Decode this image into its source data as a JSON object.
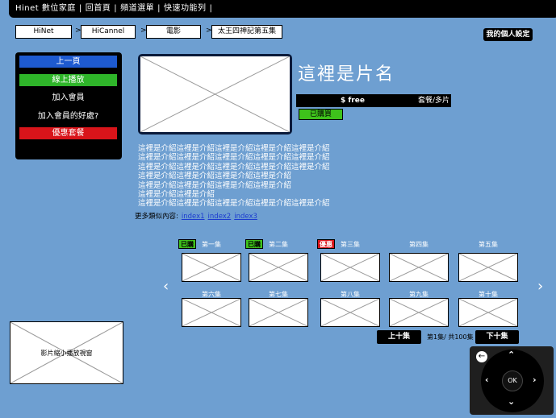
{
  "topbar": {
    "brand": "Hinet 數位家庭",
    "links": [
      "回首頁",
      "頻道選單",
      "快速功能列"
    ]
  },
  "breadcrumb": [
    "HiNet",
    "HiCannel",
    "電影",
    "太王四神記第五集"
  ],
  "breadcrumb_sep": ">",
  "my_settings": "我的個人設定",
  "menu": {
    "items": [
      {
        "label": "上一頁",
        "color": "#1e5ad0"
      },
      {
        "label": "線上播放",
        "color": "#2fb52a"
      },
      {
        "label": "加入會員",
        "color": ""
      },
      {
        "label": "加入會員的好處?",
        "color": ""
      },
      {
        "label": "優惠套餐",
        "color": "#d8141a"
      }
    ]
  },
  "movie": {
    "title": "這裡是片名",
    "price": "$ free",
    "price_unit": "套餐/多片",
    "purchased": "已購買",
    "description": [
      "這裡是介紹這裡是介紹這裡是介紹這裡是介紹這裡是介紹",
      "這裡是介紹這裡是介紹這裡是介紹這裡是介紹這裡是介紹",
      "這裡是介紹這裡是介紹這裡是介紹這裡是介紹這裡是介紹",
      "這裡是介紹這裡是介紹這裡是介紹這裡是介紹",
      "這裡是介紹這裡是介紹這裡是介紹這裡是介紹",
      "這裡是介紹這裡是介紹",
      "這裡是介紹這裡是介紹這裡是介紹這裡是介紹這裡是介紹"
    ],
    "more_label": "更多類似內容:",
    "more_links": [
      "index1",
      "index2",
      "index3"
    ]
  },
  "episodes": {
    "items": [
      {
        "label": "第一集",
        "badge": "已購",
        "badge_color": "#3ec21b"
      },
      {
        "label": "第二集",
        "badge": "已購",
        "badge_color": "#3ec21b"
      },
      {
        "label": "第三集",
        "badge": "優惠",
        "badge_color": "#d8141a"
      },
      {
        "label": "第四集",
        "badge": "",
        "badge_color": ""
      },
      {
        "label": "第五集",
        "badge": "",
        "badge_color": ""
      },
      {
        "label": "第六集",
        "badge": "",
        "badge_color": ""
      },
      {
        "label": "第七集",
        "badge": "",
        "badge_color": ""
      },
      {
        "label": "第八集",
        "badge": "",
        "badge_color": ""
      },
      {
        "label": "第九集",
        "badge": "",
        "badge_color": ""
      },
      {
        "label": "第十集",
        "badge": "",
        "badge_color": ""
      }
    ],
    "prev_arrow": "‹",
    "next_arrow": "›",
    "prev_ten": "上十集",
    "next_ten": "下十集",
    "page_info": "第1集/ 共100集"
  },
  "mini_player": {
    "label": "影片縮小播放視窗"
  },
  "remote": {
    "ok": "OK",
    "up": "⌃",
    "down": "⌄",
    "left": "‹",
    "right": "›",
    "back": "←"
  }
}
